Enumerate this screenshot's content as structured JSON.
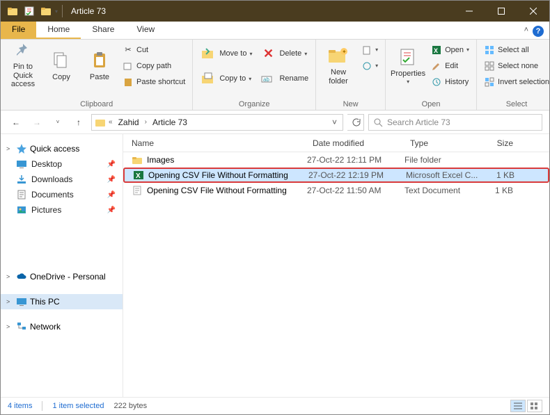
{
  "window": {
    "title": "Article 73"
  },
  "tabs": {
    "file": "File",
    "home": "Home",
    "share": "Share",
    "view": "View"
  },
  "ribbon": {
    "clipboard": {
      "label": "Clipboard",
      "pin": "Pin to Quick access",
      "copy": "Copy",
      "paste": "Paste",
      "cut": "Cut",
      "copypath": "Copy path",
      "pasteshortcut": "Paste shortcut"
    },
    "organize": {
      "label": "Organize",
      "moveto": "Move to",
      "copyto": "Copy to",
      "delete": "Delete",
      "rename": "Rename"
    },
    "new": {
      "label": "New",
      "newfolder": "New folder"
    },
    "open": {
      "label": "Open",
      "properties": "Properties",
      "open": "Open",
      "edit": "Edit",
      "history": "History"
    },
    "select": {
      "label": "Select",
      "selectall": "Select all",
      "selectnone": "Select none",
      "invert": "Invert selection"
    }
  },
  "breadcrumb": {
    "p1": "Zahid",
    "p2": "Article 73"
  },
  "search": {
    "placeholder": "Search Article 73"
  },
  "nav": {
    "quickaccess": "Quick access",
    "desktop": "Desktop",
    "downloads": "Downloads",
    "documents": "Documents",
    "pictures": "Pictures",
    "onedrive": "OneDrive - Personal",
    "thispc": "This PC",
    "network": "Network"
  },
  "columns": {
    "name": "Name",
    "date": "Date modified",
    "type": "Type",
    "size": "Size"
  },
  "files": [
    {
      "name": "Images",
      "date": "27-Oct-22 12:11 PM",
      "type": "File folder",
      "size": "",
      "icon": "folder"
    },
    {
      "name": "Opening CSV File Without Formatting",
      "date": "27-Oct-22 12:19 PM",
      "type": "Microsoft Excel C...",
      "size": "1 KB",
      "icon": "excel",
      "selected": true
    },
    {
      "name": "Opening CSV File Without Formatting",
      "date": "27-Oct-22 11:50 AM",
      "type": "Text Document",
      "size": "1 KB",
      "icon": "text"
    }
  ],
  "status": {
    "items": "4 items",
    "selected": "1 item selected",
    "bytes": "222 bytes"
  }
}
